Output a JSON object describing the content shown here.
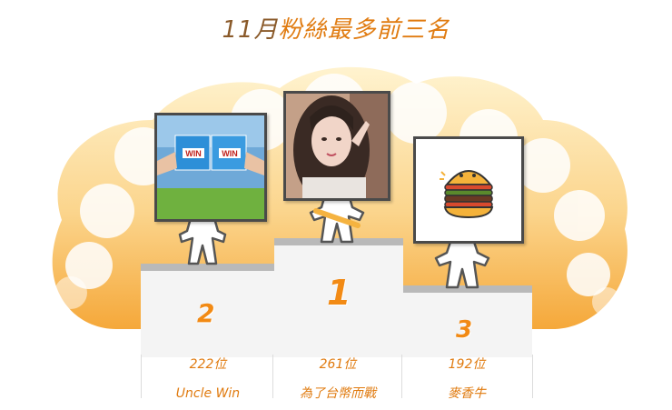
{
  "title": {
    "month": "11月",
    "text": "粉絲最多前三名"
  },
  "ranking": [
    {
      "rank": "2",
      "fans": "222位",
      "name": "Uncle Win",
      "photo": "win-puzzle"
    },
    {
      "rank": "1",
      "fans": "261位",
      "name": "為了台幣而戰",
      "photo": "portrait"
    },
    {
      "rank": "3",
      "fans": "192位",
      "name": "麥香牛",
      "photo": "burger"
    }
  ],
  "win_labels": {
    "left": "WIN",
    "right": "WIN"
  },
  "colors": {
    "accent": "#f28a14",
    "title": "#e07b10",
    "cloud_top": "#fff0c8",
    "cloud_bottom": "#f7b04a"
  }
}
